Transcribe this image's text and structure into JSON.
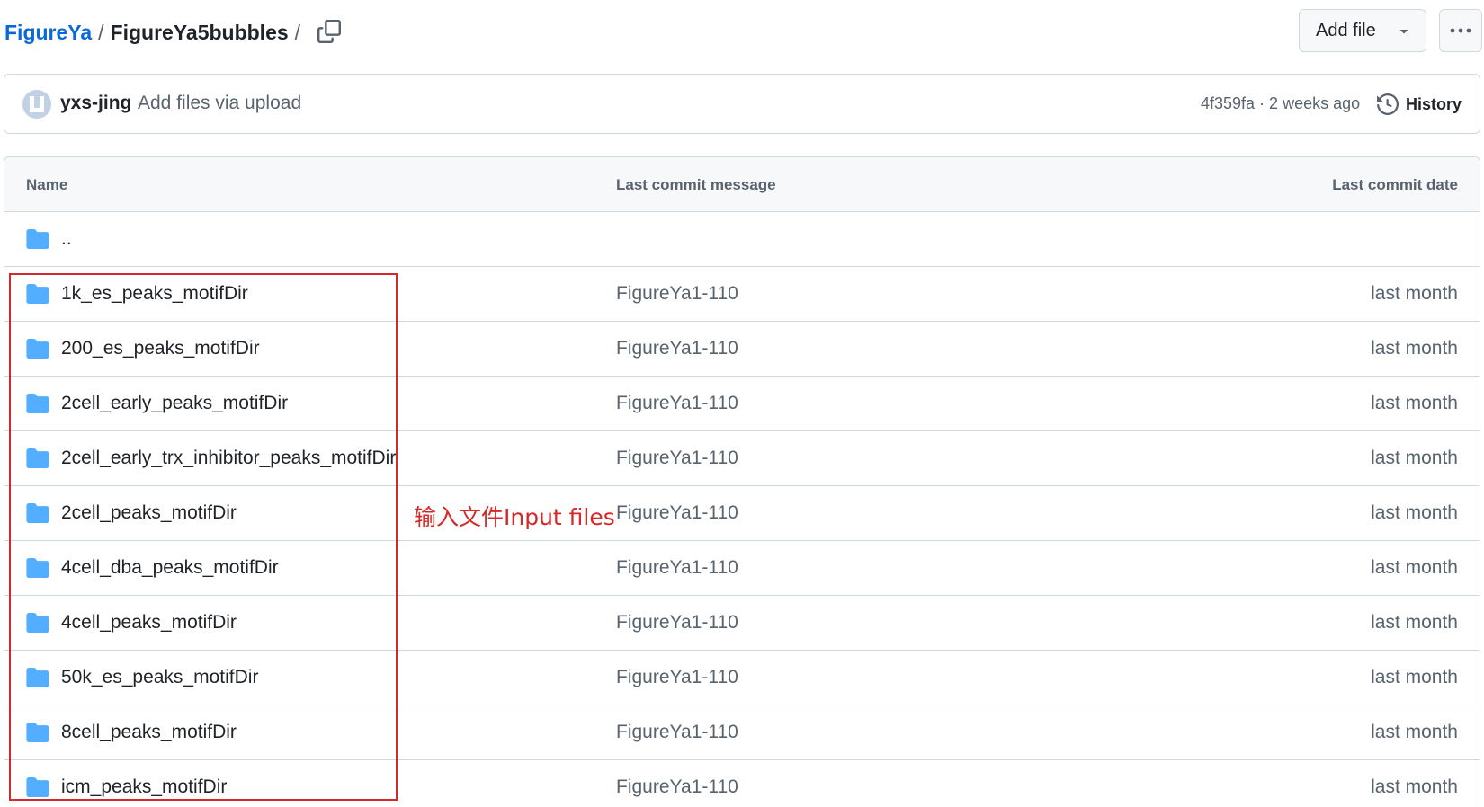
{
  "breadcrumb": {
    "repo": "FigureYa",
    "separator": "/",
    "folder": "FigureYa5bubbles",
    "trailing_separator": "/"
  },
  "toolbar": {
    "add_file_label": "Add file"
  },
  "latest_commit": {
    "author": "yxs-jing",
    "message": "Add files via upload",
    "meta": "4f359fa · 2 weeks ago",
    "history_label": "History"
  },
  "table": {
    "headers": {
      "name": "Name",
      "message": "Last commit message",
      "date": "Last commit date"
    },
    "parent_dir": "..",
    "rows": [
      {
        "name": "1k_es_peaks_motifDir",
        "message": "FigureYa1-110",
        "date": "last month"
      },
      {
        "name": "200_es_peaks_motifDir",
        "message": "FigureYa1-110",
        "date": "last month"
      },
      {
        "name": "2cell_early_peaks_motifDir",
        "message": "FigureYa1-110",
        "date": "last month"
      },
      {
        "name": "2cell_early_trx_inhibitor_peaks_motifDir",
        "message": "FigureYa1-110",
        "date": "last month"
      },
      {
        "name": "2cell_peaks_motifDir",
        "message": "FigureYa1-110",
        "date": "last month"
      },
      {
        "name": "4cell_dba_peaks_motifDir",
        "message": "FigureYa1-110",
        "date": "last month"
      },
      {
        "name": "4cell_peaks_motifDir",
        "message": "FigureYa1-110",
        "date": "last month"
      },
      {
        "name": "50k_es_peaks_motifDir",
        "message": "FigureYa1-110",
        "date": "last month"
      },
      {
        "name": "8cell_peaks_motifDir",
        "message": "FigureYa1-110",
        "date": "last month"
      },
      {
        "name": "icm_peaks_motifDir",
        "message": "FigureYa1-110",
        "date": "last month"
      }
    ]
  },
  "annotation": {
    "text": "输入文件Input files",
    "color": "#d62828"
  },
  "colors": {
    "link": "#0969da",
    "folder": "#54aeff",
    "muted": "#59636e",
    "border": "#d1d9e0"
  }
}
